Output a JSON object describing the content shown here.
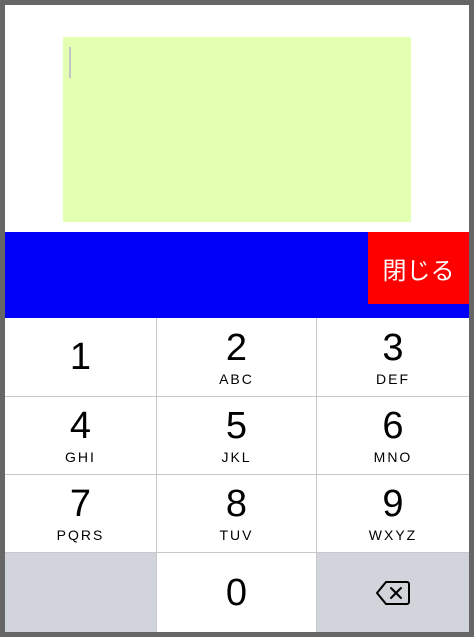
{
  "toolbar": {
    "close_label": "閉じる"
  },
  "keypad": {
    "keys": [
      {
        "digit": "1",
        "letters": ""
      },
      {
        "digit": "2",
        "letters": "ABC"
      },
      {
        "digit": "3",
        "letters": "DEF"
      },
      {
        "digit": "4",
        "letters": "GHI"
      },
      {
        "digit": "5",
        "letters": "JKL"
      },
      {
        "digit": "6",
        "letters": "MNO"
      },
      {
        "digit": "7",
        "letters": "PQRS"
      },
      {
        "digit": "8",
        "letters": "TUV"
      },
      {
        "digit": "9",
        "letters": "WXYZ"
      },
      {
        "digit": "0",
        "letters": ""
      }
    ],
    "backspace_icon": "backspace-icon"
  },
  "colors": {
    "frame": "#666666",
    "text_area": "#e2ffb2",
    "toolbar": "#0000fa",
    "close_button": "#ff0000",
    "keypad_function_key": "#d1d5db"
  }
}
